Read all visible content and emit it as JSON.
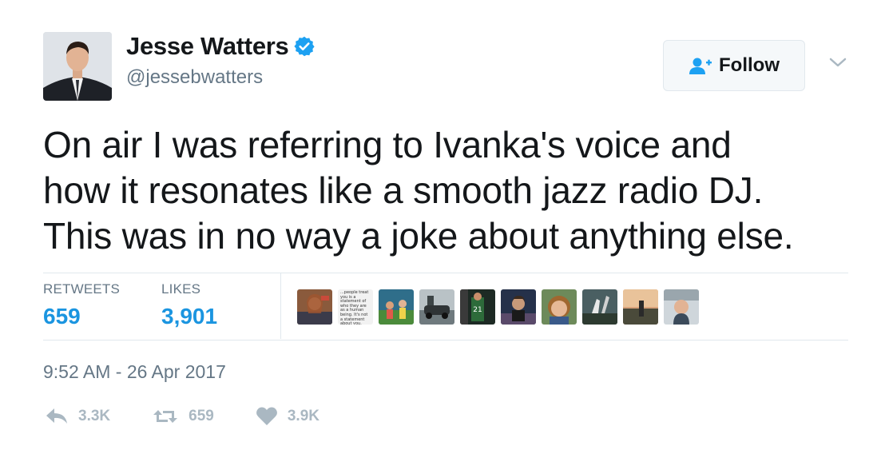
{
  "author": {
    "display_name": "Jesse Watters",
    "handle": "@jessebwatters",
    "verified": true,
    "avatar_icon": "profile-photo"
  },
  "follow": {
    "label": "Follow",
    "icon": "add-user-icon"
  },
  "tweet": {
    "lines": [
      "On air I was referring to Ivanka's voice and",
      "how it resonates like a smooth jazz radio DJ.",
      "This was in no way a joke about anything else."
    ]
  },
  "stats": {
    "retweets_label": "RETWEETS",
    "retweets_value": "659",
    "likes_label": "LIKES",
    "likes_value": "3,901"
  },
  "liker_text_avatar": "...people treat you is a statement of who they are as a human being. It's not a statement about you.",
  "timestamp": "9:52 AM - 26 Apr 2017",
  "actions": {
    "reply_count": "3.3K",
    "retweet_count": "659",
    "like_count": "3.9K"
  },
  "colors": {
    "accent": "#1b95e0",
    "muted": "#657786",
    "icon_muted": "#aab8c2",
    "border": "#e1e8ed"
  }
}
